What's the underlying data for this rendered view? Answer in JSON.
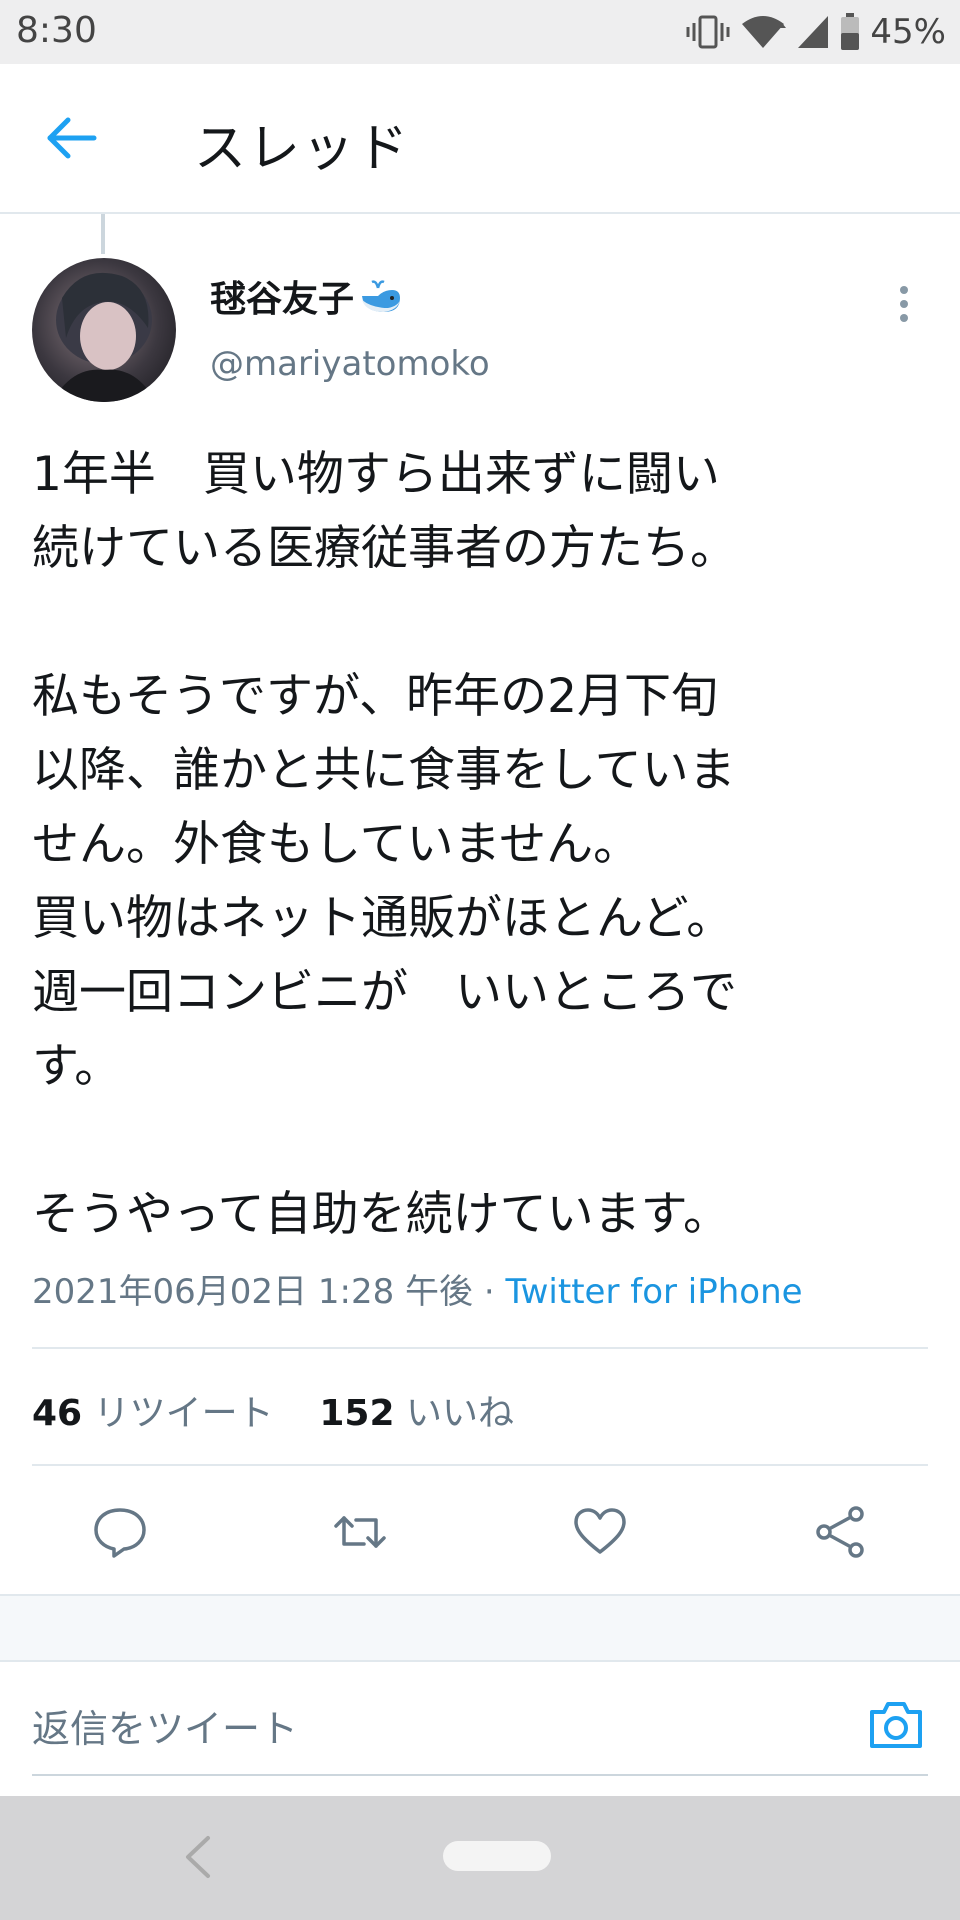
{
  "status_bar": {
    "time": "8:30",
    "battery": "45%",
    "icons": [
      "vibrate-icon",
      "wifi-icon",
      "signal-icon",
      "battery-icon"
    ]
  },
  "header": {
    "title": "スレッド",
    "back_icon": "arrow-left-icon"
  },
  "tweet": {
    "author_name": "毬谷友子",
    "author_emoji": "whale-emoji",
    "author_handle": "@mariyatomoko",
    "text": "1年半　買い物すら出来ずに闘い\n続けている医療従事者の方たち。\n\n私もそうですが、昨年の2月下旬\n以降、誰かと共に食事をしていま\nせん。外食もしていません。\n買い物はネット通販がほとんど。\n週一回コンビニが　いいところで\nす。\n\nそうやって自助を続けています。",
    "timestamp": "2021年06月02日 1:28 午後",
    "separator": " · ",
    "source": "Twitter for iPhone",
    "retweet_count": "46",
    "retweet_label": "リツイート",
    "like_count": "152",
    "like_label": "いいね"
  },
  "actions": [
    "reply-icon",
    "retweet-icon",
    "like-icon",
    "share-icon"
  ],
  "reply_box": {
    "placeholder": "返信をツイート",
    "icon": "camera-icon"
  },
  "colors": {
    "accent": "#1da1f2",
    "text": "#14171a",
    "secondary": "#657786",
    "border": "#e1e8ed"
  }
}
